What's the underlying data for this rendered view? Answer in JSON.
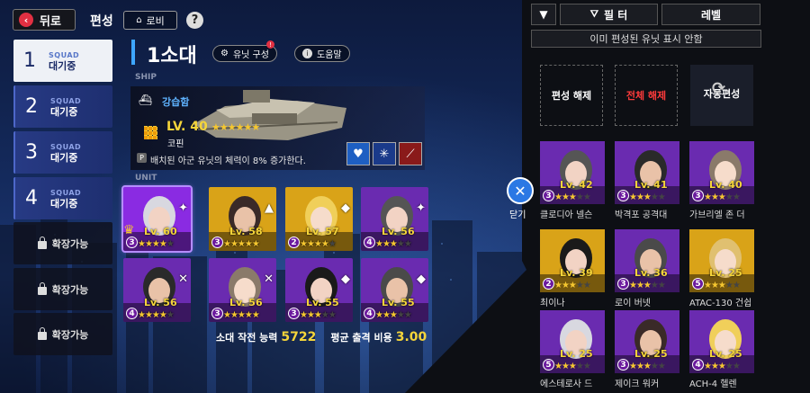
{
  "header": {
    "back_label": "뒤로",
    "title": "편성",
    "lobby_label": "로비",
    "help_icon": "?"
  },
  "squads": [
    {
      "num": "1",
      "squad": "SQUAD",
      "status": "대기중",
      "active": true
    },
    {
      "num": "2",
      "squad": "SQUAD",
      "status": "대기중",
      "active": false
    },
    {
      "num": "3",
      "squad": "SQUAD",
      "status": "대기중",
      "active": false
    },
    {
      "num": "4",
      "squad": "SQUAD",
      "status": "대기중",
      "active": false
    }
  ],
  "locked_slots": [
    "확장가능",
    "확장가능",
    "확장가능"
  ],
  "main": {
    "squad_title": "1소대",
    "unit_config_label": "유닛 구성",
    "help_label": "도움말",
    "ship_section": "SHIP",
    "unit_section": "UNIT",
    "ship": {
      "type": "강습함",
      "level": "LV. 40",
      "stars": 3,
      "max_stars": 6,
      "name": "코핀",
      "desc_prefix": "P",
      "description": "배치된 아군 유닛의 체력이 8% 증가한다."
    },
    "units": [
      {
        "level": "Lv. 60",
        "stars": 4,
        "count": "3",
        "role": "✦",
        "color": "#8a2be2",
        "leader": true
      },
      {
        "level": "Lv. 58",
        "stars": 5,
        "count": "3",
        "role": "▲",
        "color": "#d9a318"
      },
      {
        "level": "Lv. 57",
        "stars": 4,
        "count": "2",
        "role": "◆",
        "color": "#d9a318"
      },
      {
        "level": "Lv. 56",
        "stars": 3,
        "count": "4",
        "role": "✦",
        "color": "#6a2bb0"
      },
      {
        "level": "Lv. 56",
        "stars": 4,
        "count": "4",
        "role": "✕",
        "color": "#6a2bb0"
      },
      {
        "level": "Lv. 56",
        "stars": 5,
        "count": "3",
        "role": "✕",
        "color": "#6a2bb0"
      },
      {
        "level": "Lv. 55",
        "stars": 3,
        "count": "3",
        "role": "◆",
        "color": "#6a2bb0"
      },
      {
        "level": "Lv. 55",
        "stars": 3,
        "count": "4",
        "role": "◆",
        "color": "#6a2bb0"
      }
    ],
    "stats": {
      "power_label": "소대 작전 능력",
      "power_value": "5722",
      "cost_label": "평균 출격 비용",
      "cost_value": "3.00"
    },
    "close_label": "닫기"
  },
  "right_panel": {
    "filter_label": "필 터",
    "sort_label": "레벨",
    "notice": "이미 편성된 유닛 표시 안함",
    "unassign_label": "편성 해제",
    "unassign_all_label": "전체 해제",
    "auto_label": "자동편성",
    "roster": [
      {
        "name": "클로디아 넬슨",
        "level": "Lv. 42",
        "stars": 3,
        "count": "3",
        "color": "#6a2bb0"
      },
      {
        "name": "박격포 공격대",
        "level": "Lv. 41",
        "stars": 3,
        "count": "3",
        "color": "#6a2bb0"
      },
      {
        "name": "가브리엘 존 더",
        "level": "Lv. 40",
        "stars": 3,
        "count": "3",
        "color": "#6a2bb0"
      },
      {
        "name": "최이나",
        "level": "Lv. 39",
        "stars": 3,
        "count": "2",
        "color": "#d9a318"
      },
      {
        "name": "로이 버넷",
        "level": "Lv. 36",
        "stars": 3,
        "count": "3",
        "color": "#6a2bb0"
      },
      {
        "name": "ATAC-130 건쉽",
        "level": "Lv. 25",
        "stars": 3,
        "count": "5",
        "color": "#d9a318"
      },
      {
        "name": "에스테로사 드",
        "level": "Lv. 25",
        "stars": 3,
        "count": "5",
        "color": "#6a2bb0"
      },
      {
        "name": "제이크 워커",
        "level": "Lv. 25",
        "stars": 3,
        "count": "3",
        "color": "#6a2bb0"
      },
      {
        "name": "ACH-4 헬렌",
        "level": "Lv. 25",
        "stars": 3,
        "count": "4",
        "color": "#6a2bb0"
      }
    ]
  },
  "colors": {
    "accent_blue": "#3ea6ff",
    "gold": "#f5d53a",
    "red": "#e23042",
    "purple": "#6a2bb0"
  }
}
